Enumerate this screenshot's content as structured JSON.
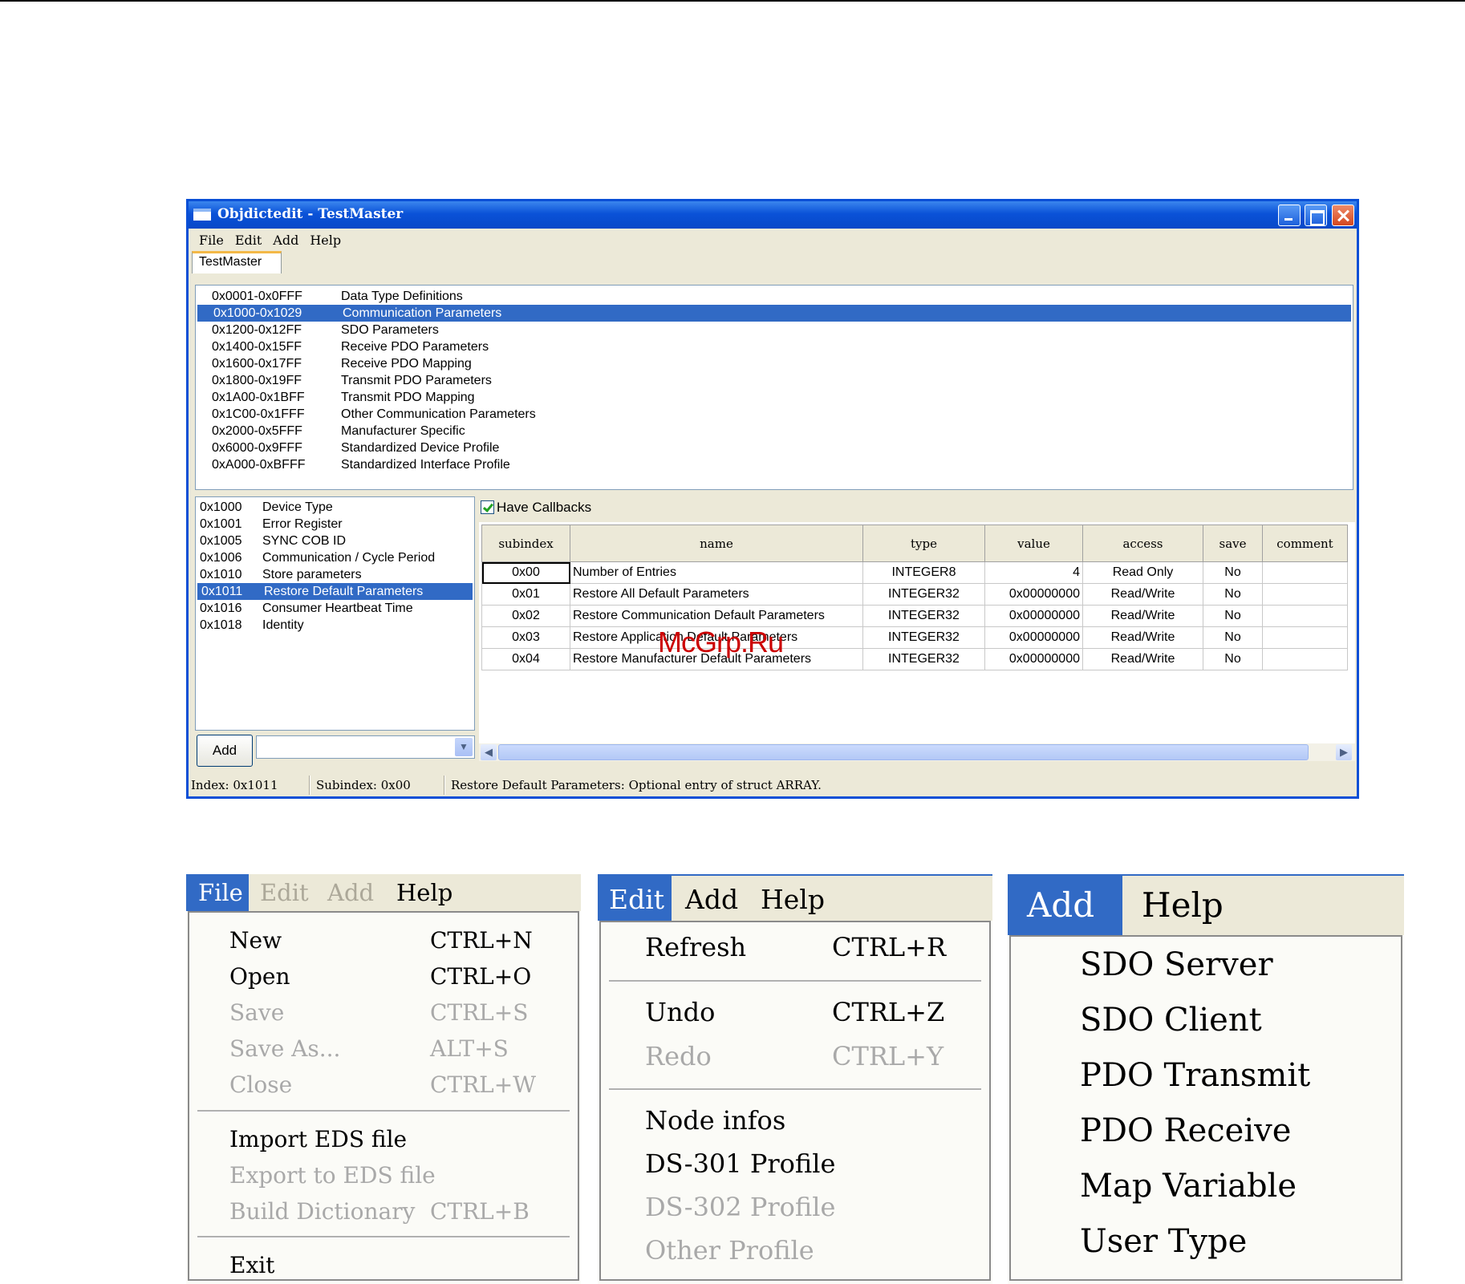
{
  "window": {
    "title": "Objdictedit - TestMaster",
    "menu": [
      "File",
      "Edit",
      "Add",
      "Help"
    ],
    "tab": "TestMaster",
    "ranges": [
      {
        "code": "0x0001-0x0FFF",
        "name": "Data Type Definitions"
      },
      {
        "code": "0x1000-0x1029",
        "name": "Communication Parameters",
        "selected": true
      },
      {
        "code": "0x1200-0x12FF",
        "name": "SDO Parameters"
      },
      {
        "code": "0x1400-0x15FF",
        "name": "Receive PDO Parameters"
      },
      {
        "code": "0x1600-0x17FF",
        "name": "Receive PDO Mapping"
      },
      {
        "code": "0x1800-0x19FF",
        "name": "Transmit PDO Parameters"
      },
      {
        "code": "0x1A00-0x1BFF",
        "name": "Transmit PDO Mapping"
      },
      {
        "code": "0x1C00-0x1FFF",
        "name": "Other Communication Parameters"
      },
      {
        "code": "0x2000-0x5FFF",
        "name": "Manufacturer Specific"
      },
      {
        "code": "0x6000-0x9FFF",
        "name": "Standardized Device Profile"
      },
      {
        "code": "0xA000-0xBFFF",
        "name": "Standardized Interface Profile"
      }
    ],
    "indexes": [
      {
        "code": "0x1000",
        "name": "Device Type"
      },
      {
        "code": "0x1001",
        "name": "Error Register"
      },
      {
        "code": "0x1005",
        "name": "SYNC COB ID"
      },
      {
        "code": "0x1006",
        "name": "Communication / Cycle Period"
      },
      {
        "code": "0x1010",
        "name": "Store parameters"
      },
      {
        "code": "0x1011",
        "name": "Restore Default Parameters",
        "selected": true
      },
      {
        "code": "0x1016",
        "name": "Consumer Heartbeat Time"
      },
      {
        "code": "0x1018",
        "name": "Identity"
      }
    ],
    "add_button": "Add",
    "have_callbacks": "Have Callbacks",
    "columns": [
      "subindex",
      "name",
      "type",
      "value",
      "access",
      "save",
      "comment"
    ],
    "rows": [
      [
        "0x00",
        "Number of Entries",
        "INTEGER8",
        "4",
        "Read Only",
        "No",
        ""
      ],
      [
        "0x01",
        "Restore All Default Parameters",
        "INTEGER32",
        "0x00000000",
        "Read/Write",
        "No",
        ""
      ],
      [
        "0x02",
        "Restore Communication Default Parameters",
        "INTEGER32",
        "0x00000000",
        "Read/Write",
        "No",
        ""
      ],
      [
        "0x03",
        "Restore Application Default Parameters",
        "INTEGER32",
        "0x00000000",
        "Read/Write",
        "No",
        ""
      ],
      [
        "0x04",
        "Restore Manufacturer Default Parameters",
        "INTEGER32",
        "0x00000000",
        "Read/Write",
        "No",
        ""
      ]
    ],
    "status": {
      "index": "Index: 0x1011",
      "subindex": "Subindex: 0x00",
      "message": "Restore Default Parameters: Optional entry of struct ARRAY."
    }
  },
  "watermark": "McGrp.Ru",
  "file_menu": {
    "bar": [
      "File",
      "Edit",
      "Add",
      "Help"
    ],
    "items": [
      {
        "label": "New",
        "shortcut": "CTRL+N",
        "enabled": true
      },
      {
        "label": "Open",
        "shortcut": "CTRL+O",
        "enabled": true
      },
      {
        "label": "Save",
        "shortcut": "CTRL+S",
        "enabled": false
      },
      {
        "label": "Save As...",
        "shortcut": "ALT+S",
        "enabled": false
      },
      {
        "label": "Close",
        "shortcut": "CTRL+W",
        "enabled": false
      },
      {
        "label": "Import EDS file",
        "shortcut": "",
        "enabled": true
      },
      {
        "label": "Export to EDS file",
        "shortcut": "",
        "enabled": false
      },
      {
        "label": "Build Dictionary",
        "shortcut": "CTRL+B",
        "enabled": false
      },
      {
        "label": "Exit",
        "shortcut": "",
        "enabled": true
      }
    ]
  },
  "edit_menu": {
    "bar": [
      "Edit",
      "Add",
      "Help"
    ],
    "items": [
      {
        "label": "Refresh",
        "shortcut": "CTRL+R",
        "enabled": true
      },
      {
        "label": "Undo",
        "shortcut": "CTRL+Z",
        "enabled": true
      },
      {
        "label": "Redo",
        "shortcut": "CTRL+Y",
        "enabled": false
      },
      {
        "label": "Node infos",
        "shortcut": "",
        "enabled": true
      },
      {
        "label": "DS-301 Profile",
        "shortcut": "",
        "enabled": true
      },
      {
        "label": "DS-302 Profile",
        "shortcut": "",
        "enabled": false
      },
      {
        "label": "Other Profile",
        "shortcut": "",
        "enabled": false
      }
    ]
  },
  "add_menu": {
    "bar": [
      "Add",
      "Help"
    ],
    "items": [
      "SDO Server",
      "SDO Client",
      "PDO Transmit",
      "PDO Receive",
      "Map Variable",
      "User Type"
    ]
  }
}
